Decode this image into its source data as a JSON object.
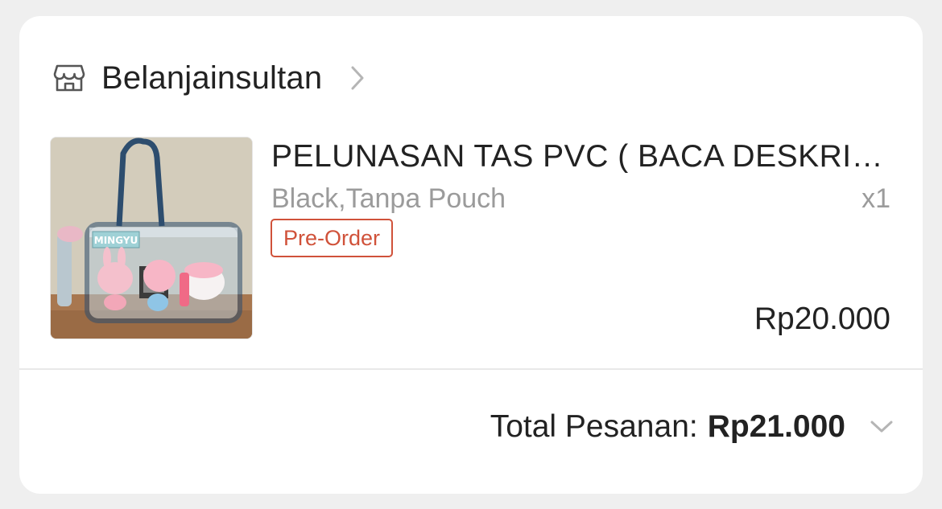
{
  "shop": {
    "name": "Belanjainsultan",
    "icon": "store-icon",
    "chevron_icon": "chevron-right-icon"
  },
  "product": {
    "title": "PELUNASAN TAS PVC ( BACA DESKRIPSI )",
    "variant": "Black,Tanpa Pouch",
    "quantity": "x1",
    "badge": "Pre-Order",
    "price": "Rp20.000",
    "image_icon": "product-photo"
  },
  "order": {
    "total_label": "Total Pesanan:",
    "total_value": "Rp21.000",
    "chevron_icon": "chevron-down-icon"
  },
  "colors": {
    "badge": "#d0523a",
    "text": "#222222",
    "muted": "#9b9b9b",
    "background": "#efefef",
    "card": "#ffffff"
  }
}
